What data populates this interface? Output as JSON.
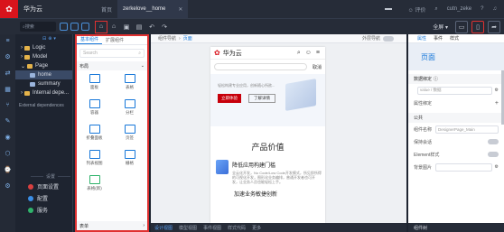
{
  "topbar": {
    "brand": "华为云",
    "tabs": [
      {
        "label": "首页"
      },
      {
        "label": "zerkelove__home"
      }
    ],
    "rating": "评价",
    "user": "cutn_zeke"
  },
  "toolbar": {
    "search_placeholder": "搜索",
    "fullscreen": "全屏"
  },
  "explorer": {
    "tree": [
      {
        "label": "Logic"
      },
      {
        "label": "Model"
      },
      {
        "label": "Page"
      },
      {
        "label": "home"
      },
      {
        "label": "summary"
      },
      {
        "label": "Internal depe..."
      }
    ],
    "external": "External dependences",
    "settings_header": "设置",
    "bottom_items": [
      {
        "label": "页面设置",
        "color": "#d94040"
      },
      {
        "label": "配置",
        "color": "#3a8ee6"
      },
      {
        "label": "服务",
        "color": "#2fb36b"
      }
    ]
  },
  "components": {
    "tab_basic": "基本组件",
    "tab_ext": "扩展组件",
    "search_placeholder": "Search",
    "group_layout": "布局",
    "items": [
      {
        "label": "面板"
      },
      {
        "label": "表格"
      },
      {
        "label": "容器"
      },
      {
        "label": "分栏"
      },
      {
        "label": "折叠面板"
      },
      {
        "label": "页签"
      },
      {
        "label": "列表视图"
      },
      {
        "label": "栅格"
      },
      {
        "label": "表格(新)"
      }
    ],
    "group_form": "表单"
  },
  "canvas": {
    "breadcrumb_root": "组件导航",
    "breadcrumb_page": "页面",
    "outline_label": "外层导航",
    "phone": {
      "brand": "华为云",
      "cancel": "取消",
      "banner_text": "轻松构建专业应用，创新随心所欲...",
      "btn_primary": "立即体验",
      "btn_secondary": "了解详情",
      "section_title": "产品价值",
      "feature1_title": "降低应用构建门槛",
      "feature1_desc": "全云化开发，No Code/Low Code开发模式，所见即所得的可视化开发，图形化业务编排，普通开发者也可开发，让业务人员也能轻松上手。",
      "feature2_title": "加速业务敏捷创新"
    },
    "footer_tabs": [
      {
        "label": "设计视图"
      },
      {
        "label": "模型视图"
      },
      {
        "label": "事件视图"
      },
      {
        "label": "样式代码"
      },
      {
        "label": "更多"
      }
    ]
  },
  "properties": {
    "tabs": [
      {
        "label": "属性"
      },
      {
        "label": "事件"
      },
      {
        "label": "样式"
      }
    ],
    "page_title": "页面",
    "sec_data": "数据绑定",
    "value_placeholder": "value / 数据",
    "prop_binding": "属性绑定",
    "sec_common": "公共",
    "field_name_label": "组件名称",
    "field_name_value": "DesignerPage_Main",
    "keep_alive": "保持会话",
    "element_style": "Element样式",
    "background": "背景图片",
    "footer": "组件树"
  }
}
